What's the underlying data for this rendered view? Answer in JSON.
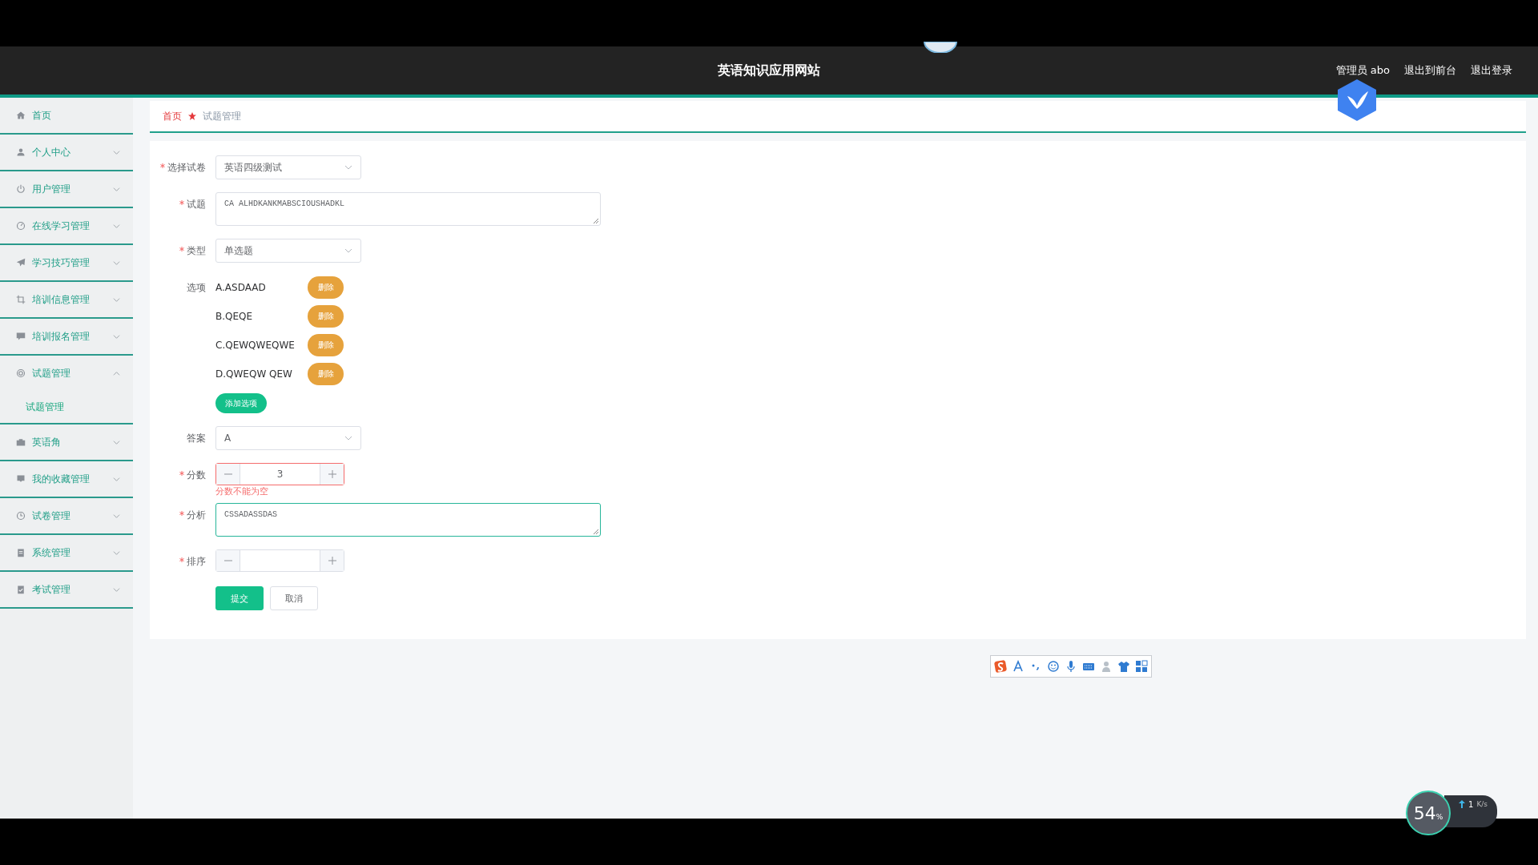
{
  "header": {
    "title": "英语知识应用网站",
    "user_label": "管理员 abo",
    "links": [
      "退出到前台",
      "退出登录"
    ]
  },
  "sidebar": {
    "items": [
      {
        "label": "首页"
      },
      {
        "label": "个人中心",
        "expanded": false
      },
      {
        "label": "用户管理",
        "expanded": false
      },
      {
        "label": "在线学习管理",
        "expanded": false
      },
      {
        "label": "学习技巧管理",
        "expanded": false
      },
      {
        "label": "培训信息管理",
        "expanded": false
      },
      {
        "label": "培训报名管理",
        "expanded": false
      },
      {
        "label": "试题管理",
        "expanded": true,
        "children": [
          {
            "label": "试题管理"
          }
        ]
      },
      {
        "label": "英语角",
        "expanded": false
      },
      {
        "label": "我的收藏管理",
        "expanded": false
      },
      {
        "label": "试卷管理",
        "expanded": false
      },
      {
        "label": "系统管理",
        "expanded": false
      },
      {
        "label": "考试管理",
        "expanded": false
      }
    ]
  },
  "breadcrumb": [
    "首页",
    "试题管理"
  ],
  "form": {
    "fields": [
      {
        "kind": "select",
        "label": "选择试卷",
        "required": true,
        "value": "英语四级测试"
      },
      {
        "kind": "textarea",
        "label": "试题",
        "required": true,
        "value": "CA ALHDKANKMABSCIOUSHADKL",
        "focused": false
      },
      {
        "kind": "select",
        "label": "类型",
        "required": true,
        "value": "单选题"
      },
      {
        "kind": "options",
        "label": "选项",
        "required": false,
        "options": [
          {
            "text": "A.ASDAAD",
            "delete_label": "删除"
          },
          {
            "text": "B.QEQE",
            "delete_label": "删除"
          },
          {
            "text": "C.QEWQWEQWE",
            "delete_label": "删除"
          },
          {
            "text": "D.QWEQW QEW",
            "delete_label": "删除"
          }
        ],
        "add_label": "添加选项"
      },
      {
        "kind": "select",
        "label": "答案",
        "required": false,
        "value": "A"
      },
      {
        "kind": "number",
        "label": "分数",
        "required": true,
        "value": "3",
        "error": "分数不能为空"
      },
      {
        "kind": "textarea",
        "label": "分析",
        "required": true,
        "value": "CSSADASSDAS",
        "focused": true
      },
      {
        "kind": "number",
        "label": "排序",
        "required": true
      }
    ],
    "buttons": [
      {
        "kind": "primary",
        "label": "提交"
      },
      {
        "kind": "default",
        "label": "取消"
      }
    ]
  },
  "net_widget": {
    "percent": "54",
    "percent_sign": "%",
    "speed": "1",
    "unit": "K/s"
  }
}
